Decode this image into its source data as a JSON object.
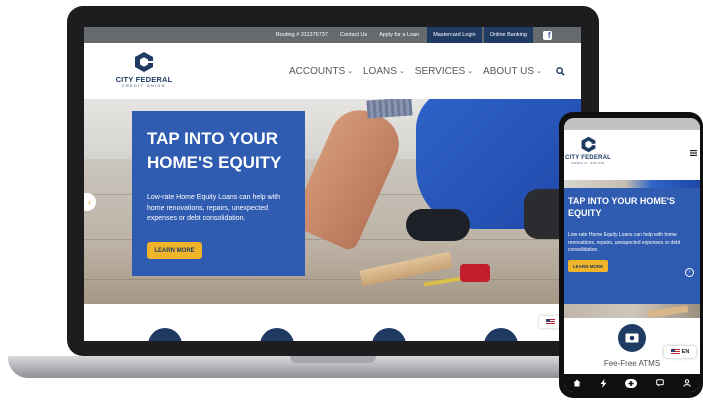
{
  "desktop": {
    "topbar": {
      "routing": "Routing # 311376737",
      "contact": "Contact Us",
      "apply": "Apply for a Loan",
      "mastercard": "Mastercard Login",
      "online_banking": "Online Banking",
      "facebook_glyph": "f"
    },
    "logo": {
      "name": "CITY FEDERAL",
      "sub": "CREDIT UNION"
    },
    "menu": [
      {
        "label": "ACCOUNTS"
      },
      {
        "label": "LOANS"
      },
      {
        "label": "SERVICES"
      },
      {
        "label": "ABOUT US"
      }
    ],
    "hero": {
      "title": "TAP INTO YOUR HOME'S EQUITY",
      "text": "Low-rate Home Equity Loans can help with home renovations, repairs, unexpected expenses or debt consolidation.",
      "button": "LEARN MORE"
    }
  },
  "mobile": {
    "logo": {
      "name": "CITY FEDERAL",
      "sub": "CREDIT UNION"
    },
    "hero": {
      "title": "TAP INTO YOUR HOME'S EQUITY",
      "text": "Low-rate Home Equity Loans can help with home renovations, repairs, unexpected expenses or debt consolidation.",
      "button": "LEARN MORE"
    },
    "feature_caption": "Fee-Free ATMS",
    "language": "EN"
  },
  "colors": {
    "brand_navy": "#1f3b63",
    "hero_blue": "#2f5bb0",
    "accent_gold": "#f0b42a",
    "topbar_gray": "#656a6e"
  }
}
